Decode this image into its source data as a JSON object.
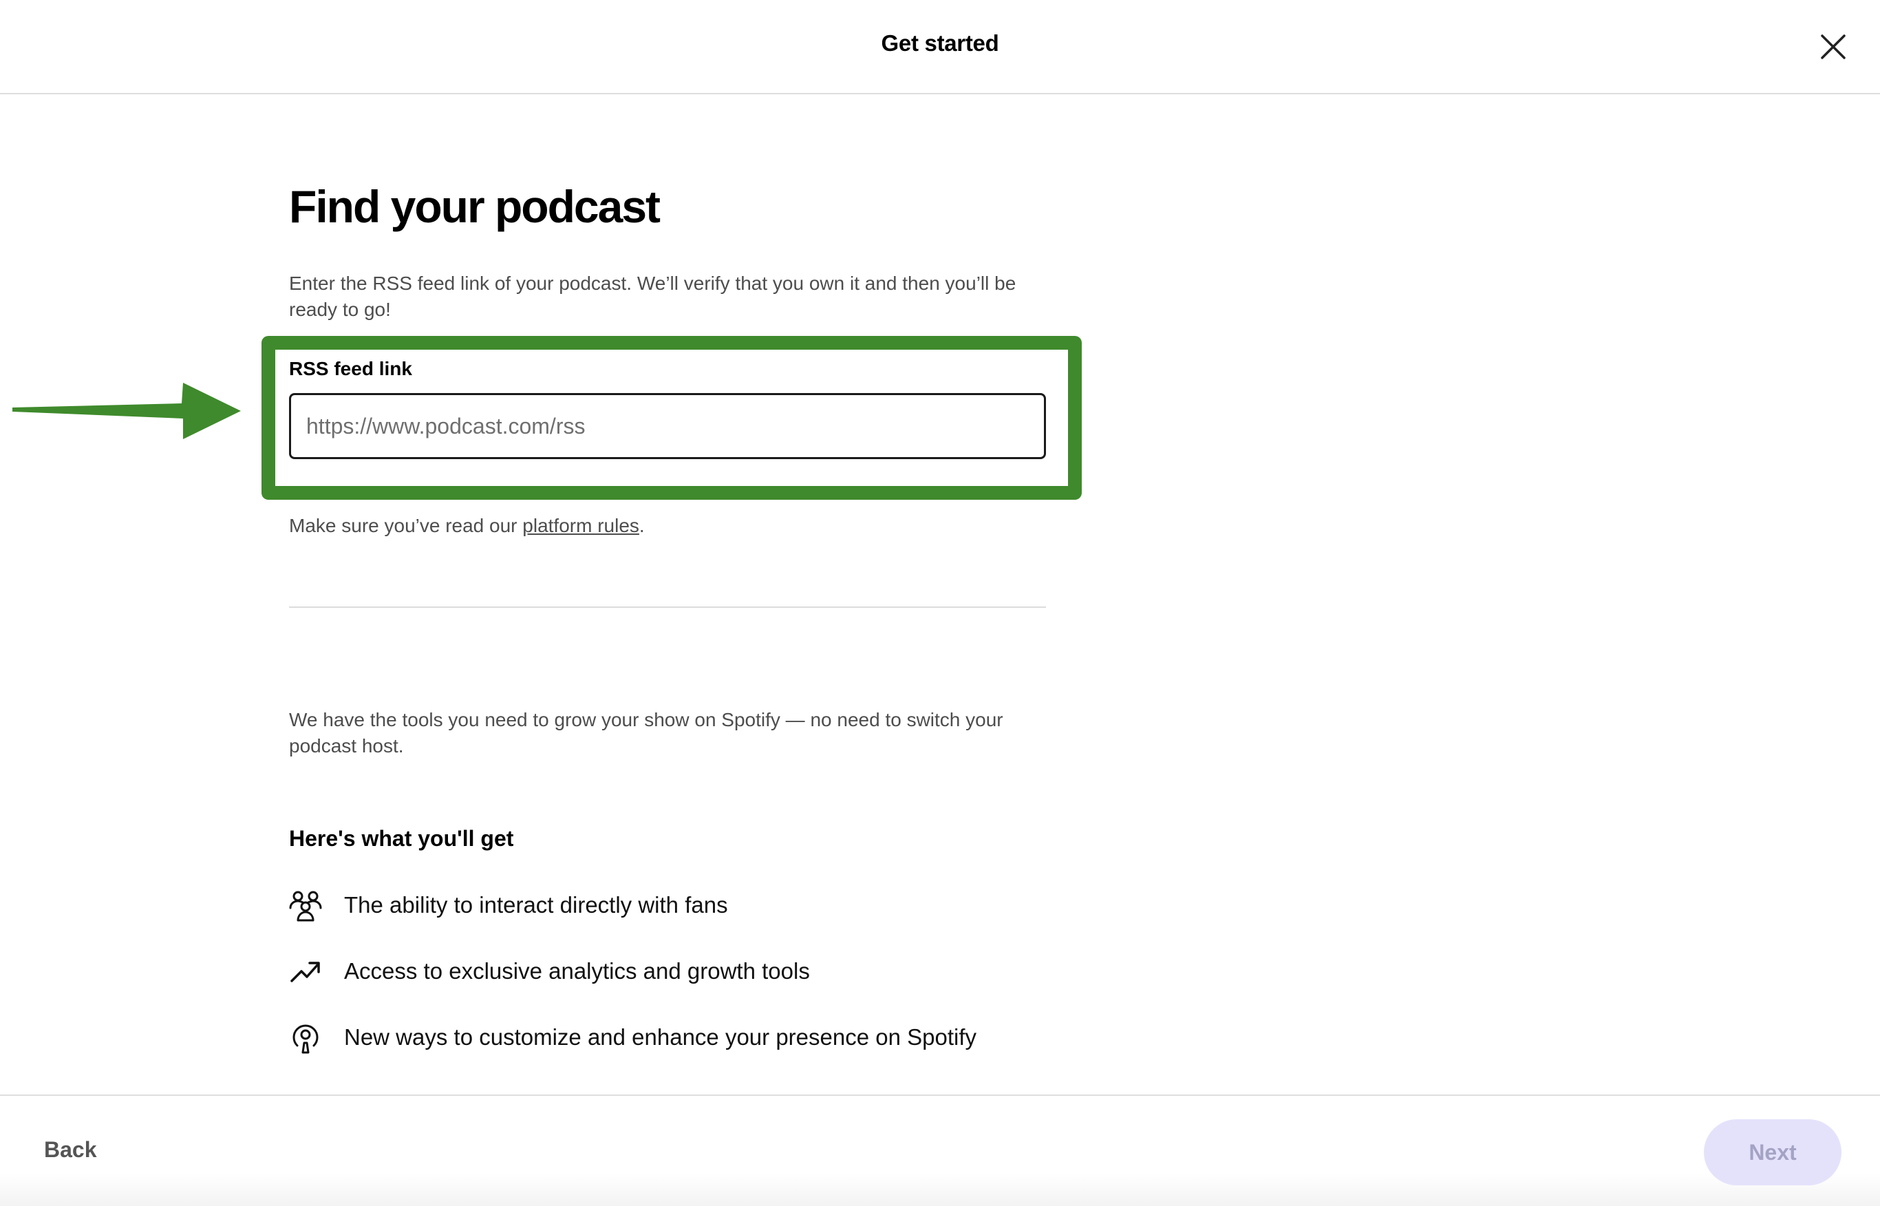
{
  "header": {
    "title": "Get started",
    "close_icon": "close-icon"
  },
  "main": {
    "title": "Find your podcast",
    "description": "Enter the RSS feed link of your podcast. We’ll verify that you own it and then you’ll be ready to go!",
    "rss_field": {
      "label": "RSS feed link",
      "value": "",
      "placeholder": "https://www.podcast.com/rss"
    },
    "rules": {
      "prefix": "Make sure you’ve read our ",
      "link_text": "platform rules",
      "suffix": "."
    },
    "tools_text": "We have the tools you need to grow your show on Spotify — no need to switch your podcast host.",
    "benefits_heading": "Here's what you'll get",
    "benefits": [
      {
        "icon": "fans-icon",
        "text": "The ability to interact directly with fans"
      },
      {
        "icon": "trending-up-icon",
        "text": "Access to exclusive analytics and growth tools"
      },
      {
        "icon": "podcast-icon",
        "text": "New ways to customize and enhance your presence on Spotify"
      }
    ]
  },
  "annotation": {
    "highlight_color": "#3f8a2c",
    "arrow_icon": "arrow-right-icon"
  },
  "footer": {
    "back_label": "Back",
    "next_label": "Next",
    "next_disabled": true
  },
  "colors": {
    "next_button_bg": "#e4e2fb",
    "next_button_text": "#a4a3c4",
    "muted_text": "#4d4d4d"
  }
}
